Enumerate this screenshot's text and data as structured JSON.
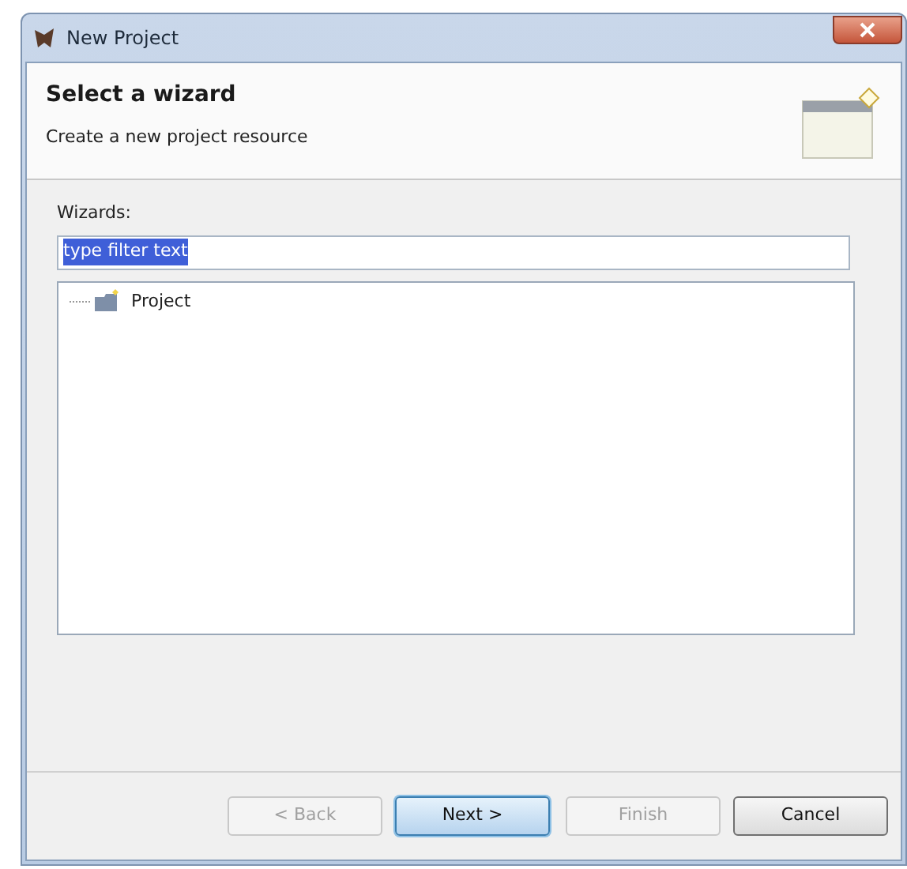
{
  "window": {
    "title": "New Project"
  },
  "header": {
    "title": "Select a wizard",
    "subtitle": "Create a new project resource"
  },
  "wizards": {
    "label": "Wizards:",
    "filter": {
      "value": "type filter text",
      "text_selected": true
    },
    "tree": [
      {
        "label": "Project",
        "selected": false
      }
    ]
  },
  "buttons": [
    {
      "label": "< Back",
      "disabled": true,
      "default": false
    },
    {
      "label": "Next >",
      "disabled": false,
      "default": true
    },
    {
      "label": "Finish",
      "disabled": true,
      "default": false
    },
    {
      "label": "Cancel",
      "disabled": false,
      "default": false
    }
  ]
}
